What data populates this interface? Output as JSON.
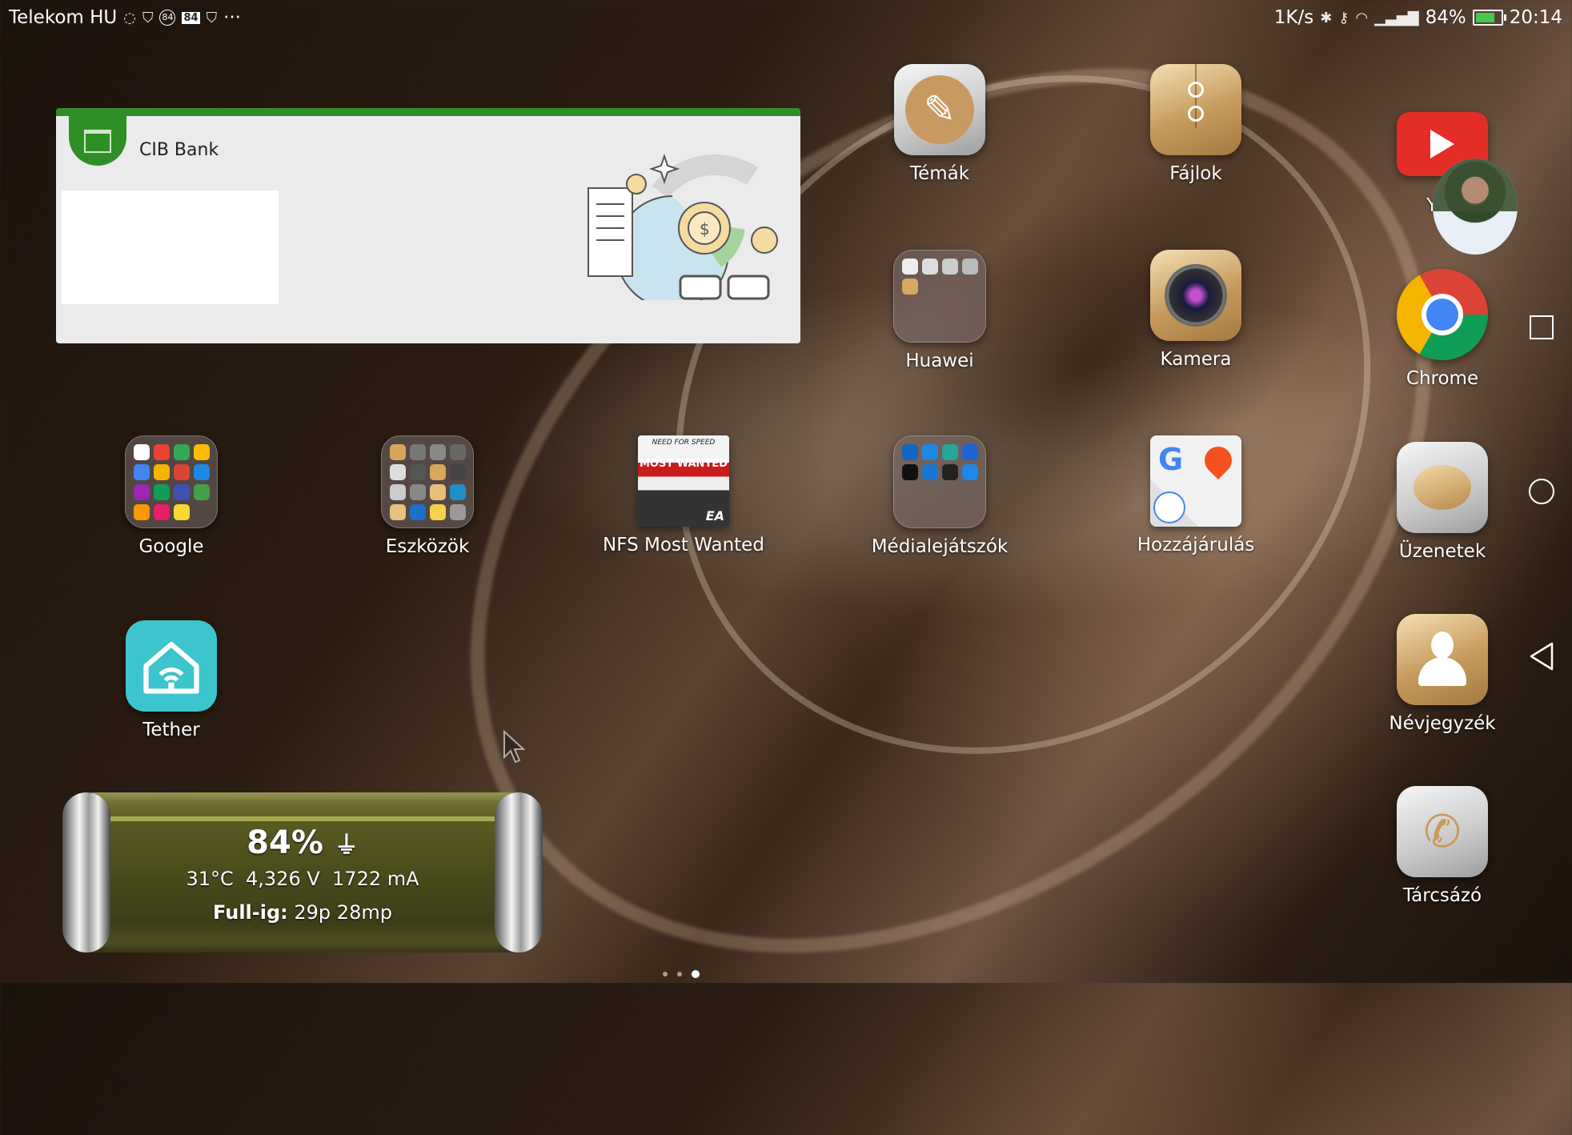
{
  "statusbar": {
    "carrier": "Telekom HU",
    "badge_84": "84",
    "badge_84b": "84",
    "more": "···",
    "speed": "1K/s",
    "signal_pct": "84%",
    "time": "20:14",
    "battery_level": 0.84
  },
  "cib_widget": {
    "name": "CIB Bank"
  },
  "apps": {
    "temak": "Témák",
    "fajlok": "Fájlok",
    "youtube": "You",
    "huawei": "Huawei",
    "kamera": "Kamera",
    "chrome": "Chrome",
    "google": "Google",
    "eszkozok": "Eszközök",
    "nfs": "NFS Most Wanted",
    "media": "Médialejátszók",
    "hozzajarulas": "Hozzájárulás",
    "uzenetek": "Üzenetek",
    "tether": "Tether",
    "nevjegyzek": "Névjegyzék",
    "tarcsazo": "Tárcsázó"
  },
  "nfs_art": {
    "line1": "NEED FOR SPEED",
    "line2": "MOST WANTED",
    "brand": "EA"
  },
  "battery_widget": {
    "percent": "84%",
    "temp": "31°C",
    "voltage": "4,326 V",
    "current": "1722 mA",
    "full_label": "Full-ig:",
    "full_value": "29p 28mp"
  },
  "pages": {
    "count": 3,
    "active": 3
  },
  "colors": {
    "cib_green": "#2e8f27",
    "tether_teal": "#3cc5cc",
    "youtube_red": "#e52d27"
  }
}
